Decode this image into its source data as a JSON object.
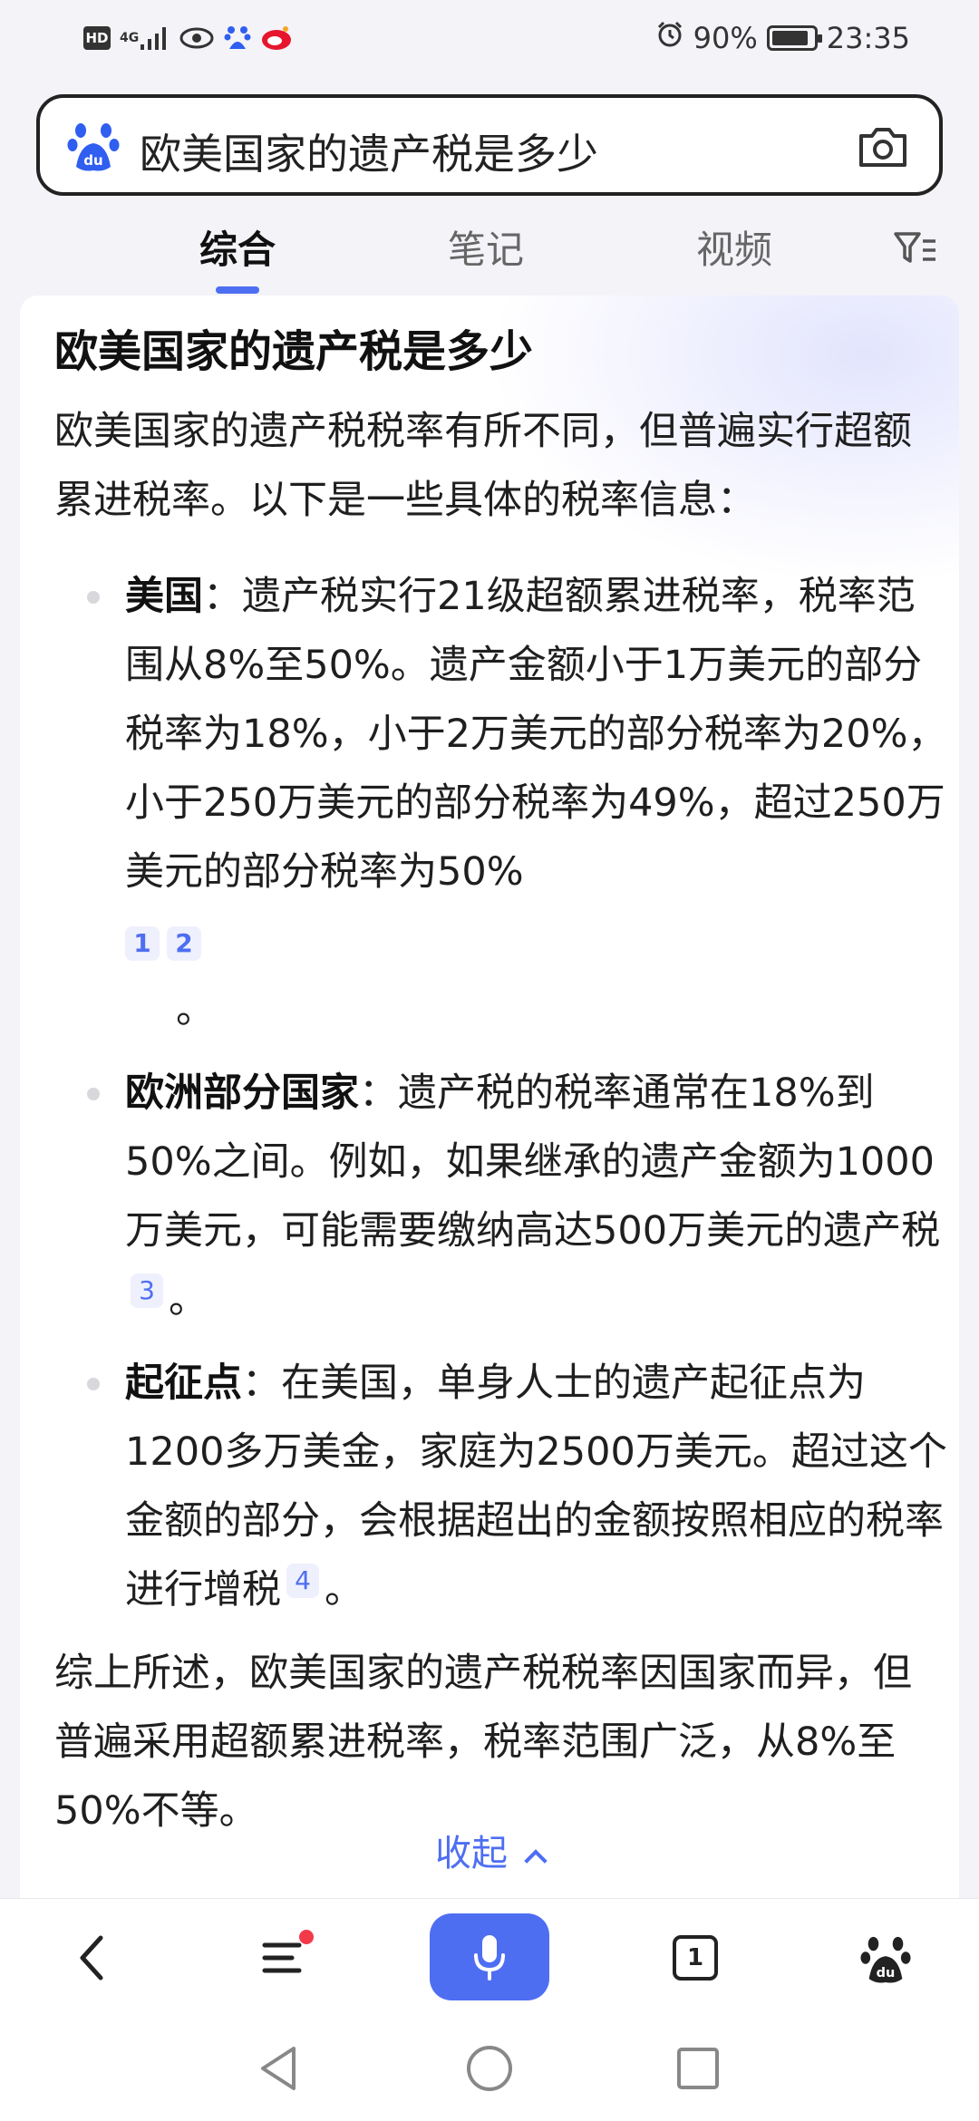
{
  "status_bar": {
    "hd": "HD",
    "network": "4G",
    "battery_percent": "90%",
    "battery_level": 0.9,
    "time": "23:35",
    "icons": [
      "hd-icon",
      "signal-icon",
      "eye-icon",
      "baidu-app-icon",
      "sina-app-icon",
      "alarm-icon",
      "battery-icon"
    ]
  },
  "search": {
    "query": "欧美国家的遗产税是多少",
    "icons": [
      "baidu-paw-icon",
      "camera-icon"
    ]
  },
  "tabs": {
    "items": [
      {
        "label": "综合",
        "active": true
      },
      {
        "label": "笔记",
        "active": false
      },
      {
        "label": "视频",
        "active": false
      }
    ],
    "filter_icon": "filter-icon"
  },
  "answer": {
    "title": "欧美国家的遗产税是多少",
    "intro": "欧美国家的遗产税税率有所不同，但普遍实行超额累进税率。以下是一些具体的税率信息：",
    "bullets": [
      {
        "term": "美国",
        "text": "：遗产税实行21级超额累进税率，税率范围从8%至50%。遗产金额小于1万美元的部分税率为18%，小于2万美元的部分税率为20%，小于250万美元的部分税率为49%，超过250万美元的部分税率为50%",
        "citations": [
          "1",
          "2"
        ],
        "end": "。"
      },
      {
        "term": "欧洲部分国家",
        "text": "：遗产税的税率通常在18%到50%之间。例如，如果继承的遗产金额为1000万美元，可能需要缴纳高达500万美元的遗产税",
        "citations": [
          "3"
        ],
        "end": "。"
      },
      {
        "term": "起征点",
        "text": "：在美国，单身人士的遗产起征点为1200多万美金，家庭为2500万美元。超过这个金额的部分，会根据超出的金额按照相应的税率进行增税",
        "citations": [
          "4"
        ],
        "end": "。"
      }
    ],
    "summary": "综上所述，欧美国家的遗产税税率因国家而异，但普遍采用超额累进税率，税率范围广泛，从8%至50%不等。",
    "collapse_label": "收起"
  },
  "bottom_bar": {
    "open_tabs": "1",
    "icons": [
      "back-icon",
      "menu-icon",
      "mic-icon",
      "tabs-icon",
      "baidu-home-icon"
    ],
    "notification_dot_color": "#f23a4a",
    "accent": "#4e6ef2"
  },
  "nav_bar": {
    "icons": [
      "nav-back-icon",
      "nav-home-icon",
      "nav-recents-icon"
    ]
  }
}
